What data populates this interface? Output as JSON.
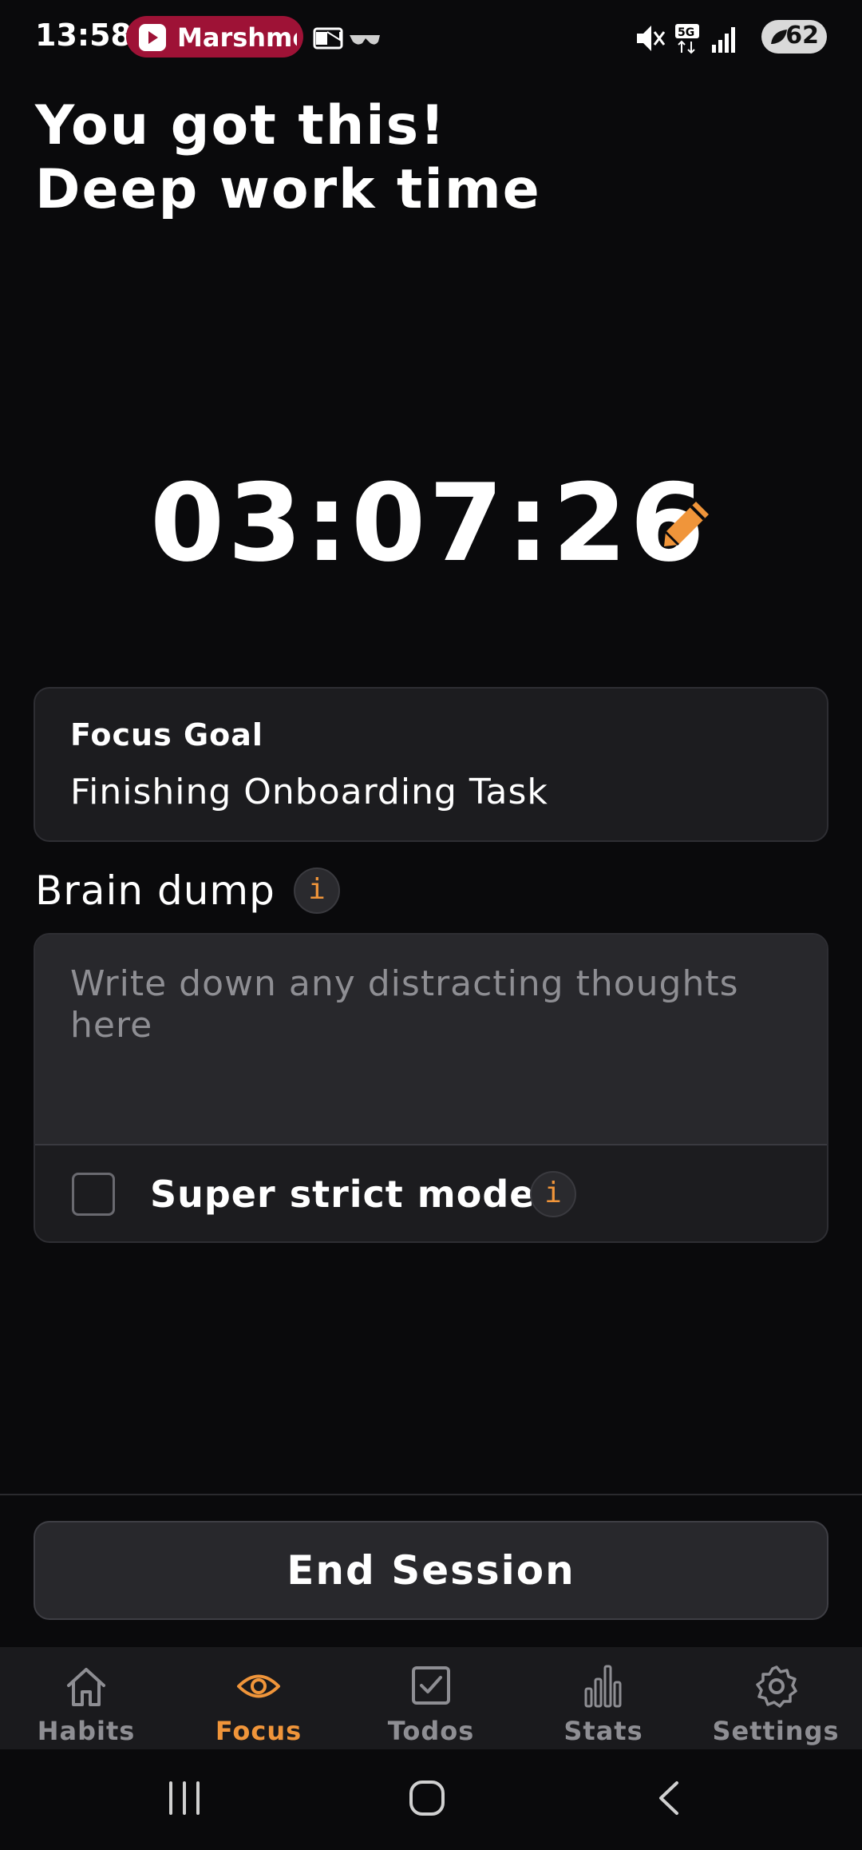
{
  "status_bar": {
    "time": "13:58",
    "media_app": "Marshmello",
    "battery": "62"
  },
  "headline": {
    "line1": "You got this!",
    "line2": "Deep work time"
  },
  "timer": {
    "value": "03:07:26",
    "edit_icon": "pencil-icon"
  },
  "focus_goal": {
    "label": "Focus Goal",
    "value": "Finishing Onboarding Task"
  },
  "brain_dump": {
    "title": "Brain dump",
    "info": "i",
    "placeholder": "Write down any distracting thoughts here",
    "value": ""
  },
  "strict_mode": {
    "label": "Super strict mode",
    "checked": false,
    "info": "i"
  },
  "end_session": {
    "label": "End Session"
  },
  "bottom_nav": {
    "items": [
      {
        "label": "Habits",
        "icon": "home-icon",
        "active": false
      },
      {
        "label": "Focus",
        "icon": "eye-icon",
        "active": true
      },
      {
        "label": "Todos",
        "icon": "checkbox-icon",
        "active": false
      },
      {
        "label": "Stats",
        "icon": "bar-chart-icon",
        "active": false
      },
      {
        "label": "Settings",
        "icon": "gear-icon",
        "active": false
      }
    ]
  },
  "colors": {
    "accent": "#f0953a",
    "background": "#0a0a0c",
    "card": "#1c1c1f",
    "media_pill": "#9e1236"
  }
}
